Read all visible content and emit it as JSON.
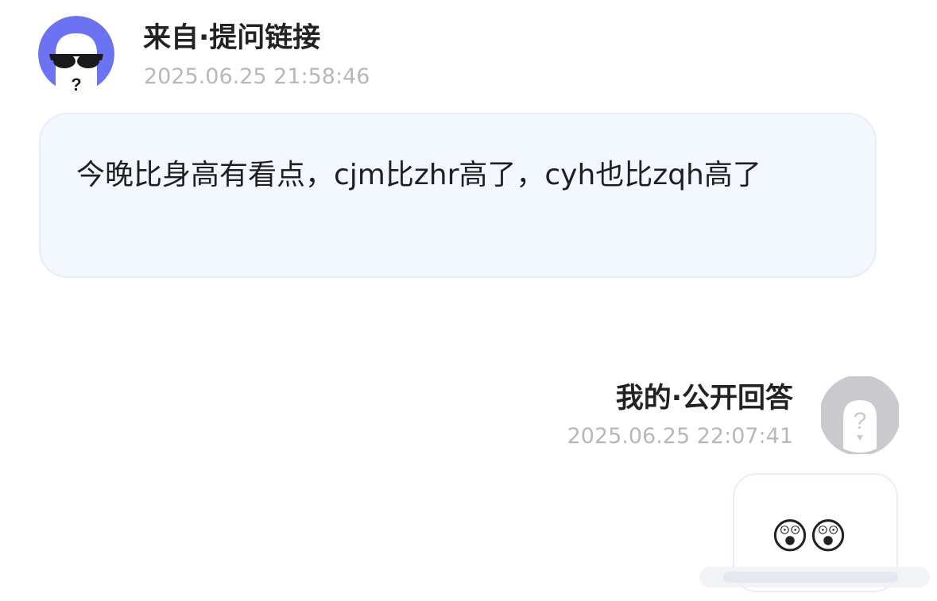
{
  "question": {
    "sender_label": "来自·提问链接",
    "timestamp": "2025.06.25 21:58:46",
    "text": "今晚比身高有看点，cjm比zhr高了，cyh也比zqh高了"
  },
  "answer": {
    "sender_label": "我的·公开回答",
    "timestamp": "2025.06.25 22:07:41",
    "text": "😲😲"
  },
  "colors": {
    "avatar_bg": "#6b73f3",
    "question_bubble_bg": "#f3f7fe",
    "bubble_border": "#e6eefc",
    "timestamp": "#b7b7bc",
    "answer_avatar_ring": "#c9c9ce"
  },
  "icons": {
    "question_avatar": "anonymous-sunglasses-avatar-icon",
    "answer_avatar": "anonymous-question-avatar-icon"
  }
}
